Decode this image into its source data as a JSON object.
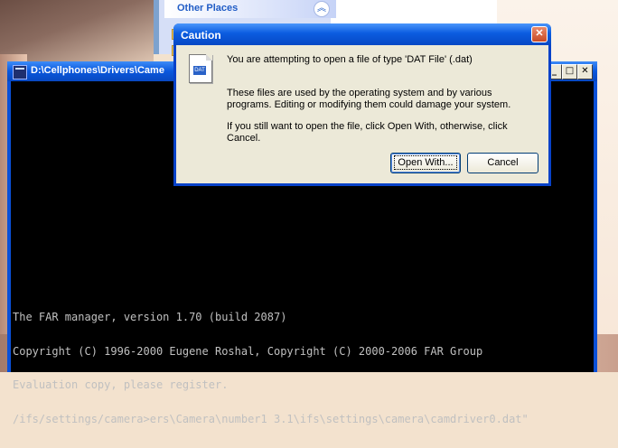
{
  "explorer": {
    "task_header": "Other Places"
  },
  "console": {
    "title": "D:\\Cellphones\\Drivers\\Came",
    "buttons": {
      "minimize": "_",
      "maximize": "□",
      "close": "✕"
    },
    "lines": [
      "The FAR manager, version 1.70 (build 2087)",
      "Copyright (C) 1996-2000 Eugene Roshal, Copyright (C) 2000-2006 FAR Group",
      "Evaluation copy, please register.",
      "/ifs/settings/camera>ers\\Camera\\number1 3.1\\ifs\\settings\\camera\\camdriver0.dat\""
    ]
  },
  "dialog": {
    "title": "Caution",
    "close": "✕",
    "message": "You are attempting to open a file of type 'DAT File' (.dat)",
    "detail": "These files are used by the operating system and by various programs. Editing or modifying them could damage your system.",
    "instruction": "If you still want to open the file, click Open With, otherwise, click Cancel.",
    "open_with_label": "Open With...",
    "cancel_label": "Cancel",
    "icon_text": "DAT"
  }
}
